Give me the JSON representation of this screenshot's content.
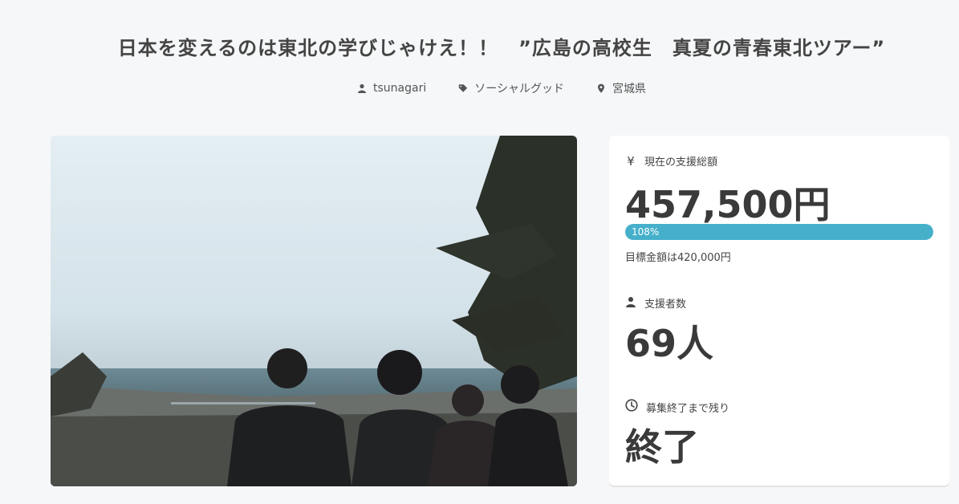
{
  "header": {
    "title": "日本を変えるのは東北の学びじゃけえ！！　”広島の高校生　真夏の青春東北ツアー”",
    "meta": [
      {
        "icon": "user-icon",
        "label": "tsunagari"
      },
      {
        "icon": "tag-icon",
        "label": "ソーシャルグッド"
      },
      {
        "icon": "location-pin-icon",
        "label": "宮城県"
      }
    ]
  },
  "hero": {
    "alt": "Four people looking toward the sea under an evening sky with a pine tree"
  },
  "stats": {
    "amount_label": "現在の支援総額",
    "amount_value": "457,500円",
    "progress": {
      "percent_value": 108,
      "percent_label": "108%",
      "goal_text": "目標金額は420,000円"
    },
    "supporters_label": "支援者数",
    "supporters_value": "69人",
    "remaining_label": "募集終了まで残り",
    "remaining_value": "終了"
  },
  "colors": {
    "background": "#f6f7f8",
    "card": "#ffffff",
    "accent": "#46b0cb",
    "text_dark": "#3a3a3a"
  }
}
